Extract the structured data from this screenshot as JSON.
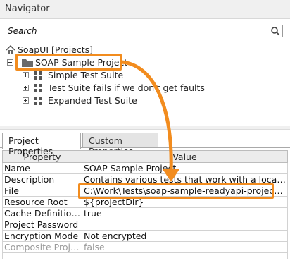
{
  "navigator": {
    "title": "Navigator",
    "search_placeholder": "Search",
    "root_label": "SoapUI [Projects]",
    "project_label": "SOAP Sample Project",
    "suites": [
      {
        "label": "Simple Test Suite"
      },
      {
        "label": "Test Suite fails if we don't get faults"
      },
      {
        "label": "Expanded Test Suite"
      }
    ]
  },
  "tabs": [
    {
      "label": "Project Properties",
      "active": true
    },
    {
      "label": "Custom Properties",
      "active": false
    }
  ],
  "properties_table": {
    "headers": [
      "Property",
      "Value"
    ],
    "rows": [
      {
        "name": "Name",
        "value": "SOAP Sample Project"
      },
      {
        "name": "Description",
        "value": "Contains various tests that work with a local virtual s..."
      },
      {
        "name": "File",
        "value": "C:\\Work\\Tests\\soap-sample-readyapi-project.xml"
      },
      {
        "name": "Resource Root",
        "value": "${projectDir}"
      },
      {
        "name": "Cache Definitions",
        "value": "true"
      },
      {
        "name": "Project Password",
        "value": ""
      },
      {
        "name": "Encryption Mode",
        "value": "Not encrypted"
      },
      {
        "name": "Composite Project",
        "value": "false"
      }
    ]
  },
  "colors": {
    "highlight": "#f28c1e",
    "arrow": "#f28c1e"
  },
  "icons": {
    "search": "search-icon",
    "root": "home-icon",
    "project": "folder-icon",
    "suite": "test-suite-icon"
  }
}
